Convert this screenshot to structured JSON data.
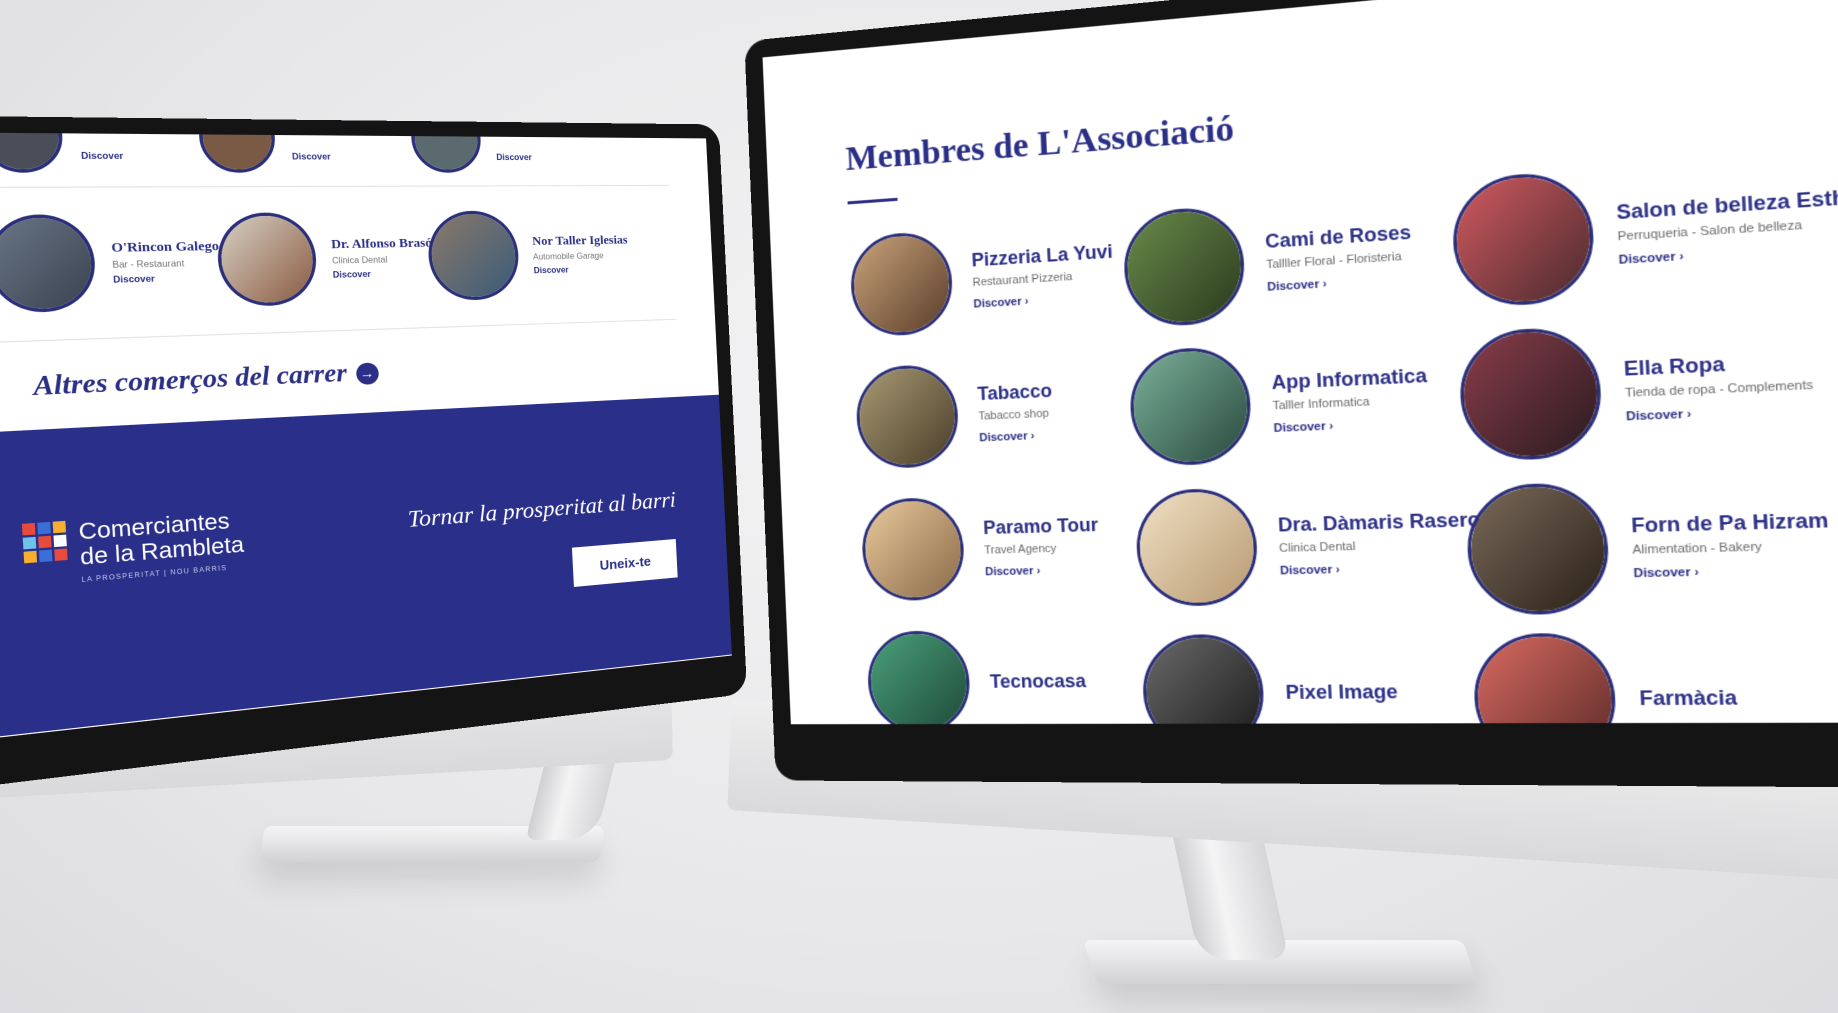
{
  "left_screen": {
    "top_row_partial": [
      {
        "discover": "Discover"
      },
      {
        "discover": "Discover"
      },
      {
        "discover": "Discover"
      }
    ],
    "members": [
      {
        "name": "O'Rincon Galego",
        "category": "Bar - Restaurant",
        "discover": "Discover"
      },
      {
        "name": "Dr. Alfonso Brasó Serra",
        "category": "Clinica Dental",
        "discover": "Discover"
      },
      {
        "name": "Nor Taller Iglesias",
        "category": "Automobile Garage",
        "discover": "Discover"
      }
    ],
    "other_shops_label": "Altres comerços del carrer",
    "footer": {
      "logo_line1": "Comerciantes",
      "logo_line2": "de la Rambleta",
      "logo_sub": "LA PROSPERITAT | NOU BARRIS",
      "tagline": "Tornar la prosperitat al barri",
      "cta": "Uneix-te",
      "logo_colors": [
        "#e84b3c",
        "#3b6fd8",
        "#f5b12e",
        "#6fc3e8",
        "#e84b3c",
        "#ffffff",
        "#f5b12e",
        "#3b6fd8",
        "#e84b3c"
      ]
    }
  },
  "right_screen": {
    "title": "Membres de L'Associació",
    "members": [
      {
        "name": "Pizzeria La Yuvi",
        "category": "Restaurant Pizzeria",
        "discover": "Discover",
        "color": "#8c6a4a"
      },
      {
        "name": "Cami de Roses",
        "category": "Tallller Floral - Floristeria",
        "discover": "Discover",
        "color": "#3f5a2e"
      },
      {
        "name": "Salon de belleza Esther",
        "category": "Perruqueria - Salon de belleza",
        "discover": "Discover",
        "color": "#b8444a"
      },
      {
        "name": "Tabacco",
        "category": "Tabacco shop",
        "discover": "Discover",
        "color": "#7a6a48"
      },
      {
        "name": "App Informatica",
        "category": "Talller Informatica",
        "discover": "Discover",
        "color": "#4f7a6a"
      },
      {
        "name": "Ella Ropa",
        "category": "Tienda de ropa - Complements",
        "discover": "Discover",
        "color": "#6a2f3a"
      },
      {
        "name": "Paramo Tour",
        "category": "Travel Agency",
        "discover": "Discover",
        "color": "#c99a6a"
      },
      {
        "name": "Dra. Dàmaris Rasero",
        "category": "Clinica Dental",
        "discover": "Discover",
        "color": "#d8c3a0"
      },
      {
        "name": "Forn de Pa Hizram",
        "category": "Alimentation - Bakery",
        "discover": "Discover",
        "color": "#5a4a3a"
      },
      {
        "name": "Tecnocasa",
        "category": "",
        "discover": "",
        "color": "#2f7a5a"
      },
      {
        "name": "Pixel Image",
        "category": "",
        "discover": "",
        "color": "#3a3a3a"
      },
      {
        "name": "Farmàcia",
        "category": "",
        "discover": "",
        "color": "#c0504a"
      }
    ]
  }
}
